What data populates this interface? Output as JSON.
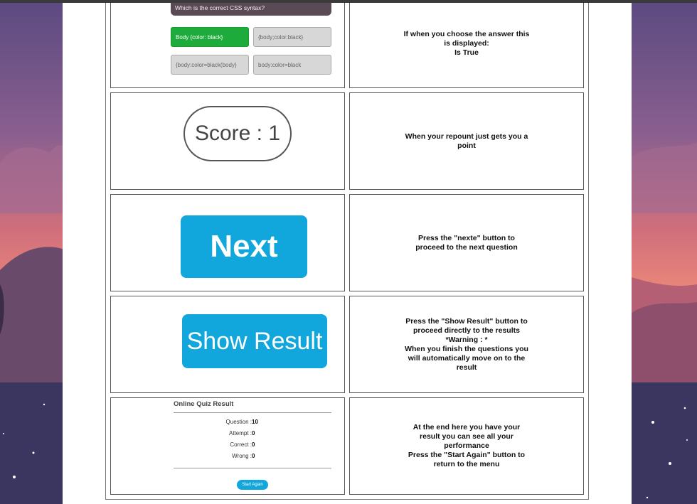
{
  "quiz_preview": {
    "question": "Which is the correct CSS syntax?",
    "options": [
      "Body {color: black}",
      "{body;color:black}",
      "{body:color=black(body}",
      "body:color=black"
    ]
  },
  "score_preview": {
    "label": "Score : 1"
  },
  "next_preview": {
    "label": "Next"
  },
  "show_result_preview": {
    "label": "Show Result"
  },
  "result_preview": {
    "title": "Online Quiz Result",
    "rows": [
      {
        "label": "Question :",
        "value": "10"
      },
      {
        "label": "Attempt :",
        "value": "0"
      },
      {
        "label": "Correct :",
        "value": "0"
      },
      {
        "label": "Wrong :",
        "value": "0"
      }
    ],
    "button": "Start Again"
  },
  "descriptions": {
    "row1": [
      "If when you choose the answer this",
      "is displayed:",
      "Is True"
    ],
    "row2": [
      "When your repount just gets you a",
      "point"
    ],
    "row3": [
      "Press the \"nexte\" button to",
      "proceed to the next question"
    ],
    "row4": [
      "Press the \"Show Result\" button to",
      "proceed directly to the results",
      "*Warning : *",
      "When you finish the questions you",
      "will automatically move on to the",
      "result"
    ],
    "row5": [
      "At the end here you have your",
      "result you can see all your",
      "performance",
      "Press the \"Start Again\" button to",
      "return to the menu"
    ]
  },
  "colors": {
    "correct": "#1dab3b",
    "accent_blue": "#11a6dc",
    "sky_top": "#5d4a7e",
    "sky_glow": "#e56e6e"
  }
}
